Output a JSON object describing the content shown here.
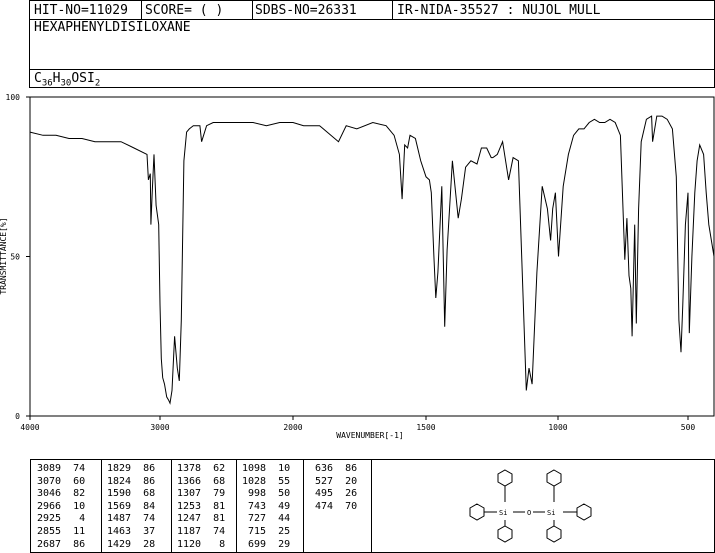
{
  "header": {
    "hit_no": "HIT-NO=11029",
    "score": "SCORE=  (   )",
    "sdbs_no": "SDBS-NO=26331",
    "ir_nida": "IR-NIDA-35527 : NUJOL MULL"
  },
  "compound": {
    "name": "HEXAPHENYLDISILOXANE",
    "formula_main": "C",
    "formula_sub1": "36",
    "formula_h": "H",
    "formula_sub2": "30",
    "formula_rest": "OSI",
    "formula_sub3": "2"
  },
  "chart_data": {
    "type": "line",
    "xlabel": "WAVENUMBER[-1]",
    "ylabel": "TRANSMITTANCE[%]",
    "xlim": [
      4000,
      400
    ],
    "ylim": [
      0,
      100
    ],
    "x_ticks": [
      4000,
      3000,
      2000,
      1500,
      1000,
      500
    ],
    "y_ticks": [
      0,
      50,
      100
    ],
    "grid": false,
    "series": [
      {
        "x": [
          4000,
          3900,
          3800,
          3700,
          3600,
          3500,
          3400,
          3300,
          3200,
          3100,
          3089,
          3075,
          3070,
          3060,
          3046,
          3030,
          3010,
          3000,
          2990,
          2980,
          2966,
          2950,
          2935,
          2925,
          2910,
          2890,
          2870,
          2855,
          2840,
          2820,
          2800,
          2780,
          2750,
          2700,
          2687,
          2650,
          2600,
          2500,
          2400,
          2300,
          2200,
          2100,
          2000,
          1960,
          1900,
          1829,
          1800,
          1760,
          1700,
          1650,
          1620,
          1600,
          1590,
          1580,
          1569,
          1560,
          1540,
          1520,
          1500,
          1487,
          1480,
          1470,
          1463,
          1455,
          1440,
          1429,
          1420,
          1400,
          1378,
          1366,
          1350,
          1330,
          1307,
          1290,
          1270,
          1253,
          1247,
          1230,
          1210,
          1187,
          1170,
          1150,
          1120,
          1110,
          1098,
          1080,
          1060,
          1040,
          1028,
          1020,
          1010,
          998,
          980,
          960,
          940,
          920,
          900,
          880,
          860,
          840,
          820,
          800,
          780,
          760,
          743,
          735,
          727,
          720,
          715,
          705,
          699,
          690,
          680,
          660,
          640,
          636,
          620,
          600,
          580,
          560,
          545,
          535,
          527,
          520,
          510,
          500,
          495,
          485,
          474,
          465,
          455,
          440,
          430,
          420,
          400
        ],
        "y": [
          89,
          88,
          88,
          87,
          87,
          86,
          86,
          86,
          84,
          82,
          74,
          76,
          60,
          70,
          82,
          66,
          60,
          35,
          18,
          12,
          10,
          6,
          5,
          4,
          8,
          25,
          15,
          11,
          30,
          80,
          89,
          90,
          91,
          91,
          86,
          91,
          92,
          92,
          92,
          92,
          91,
          92,
          92,
          91,
          91,
          86,
          91,
          90,
          92,
          91,
          88,
          82,
          68,
          85,
          84,
          88,
          87,
          80,
          75,
          74,
          70,
          50,
          37,
          45,
          72,
          28,
          52,
          80,
          62,
          68,
          78,
          80,
          79,
          84,
          84,
          81,
          81,
          82,
          86,
          74,
          81,
          80,
          8,
          15,
          10,
          45,
          72,
          65,
          55,
          65,
          70,
          50,
          72,
          82,
          88,
          90,
          90,
          92,
          93,
          92,
          92,
          93,
          92,
          88,
          49,
          62,
          44,
          40,
          25,
          60,
          29,
          65,
          86,
          93,
          94,
          86,
          94,
          94,
          93,
          90,
          75,
          30,
          20,
          35,
          60,
          70,
          26,
          50,
          70,
          80,
          85,
          82,
          70,
          60,
          50
        ]
      }
    ]
  },
  "peak_table": {
    "col1": [
      "3089  74",
      "3070  60",
      "3046  82",
      "2966  10",
      "2925   4",
      "2855  11",
      "2687  86"
    ],
    "col2": [
      "1829  86",
      "1824  86",
      "1590  68",
      "1569  84",
      "1487  74",
      "1463  37",
      "1429  28"
    ],
    "col3": [
      "1378  62",
      "1366  68",
      "1307  79",
      "1253  81",
      "1247  81",
      "1187  74",
      "1120   8"
    ],
    "col4": [
      "1098  10",
      "1028  55",
      " 998  50",
      " 743  49",
      " 727  44",
      " 715  25",
      " 699  29"
    ],
    "col5": [
      " 636  86",
      " 527  20",
      " 495  26",
      " 474  70"
    ]
  },
  "structure": {
    "atom_si_left": "Si",
    "atom_o": "O",
    "atom_si_right": "Si"
  }
}
